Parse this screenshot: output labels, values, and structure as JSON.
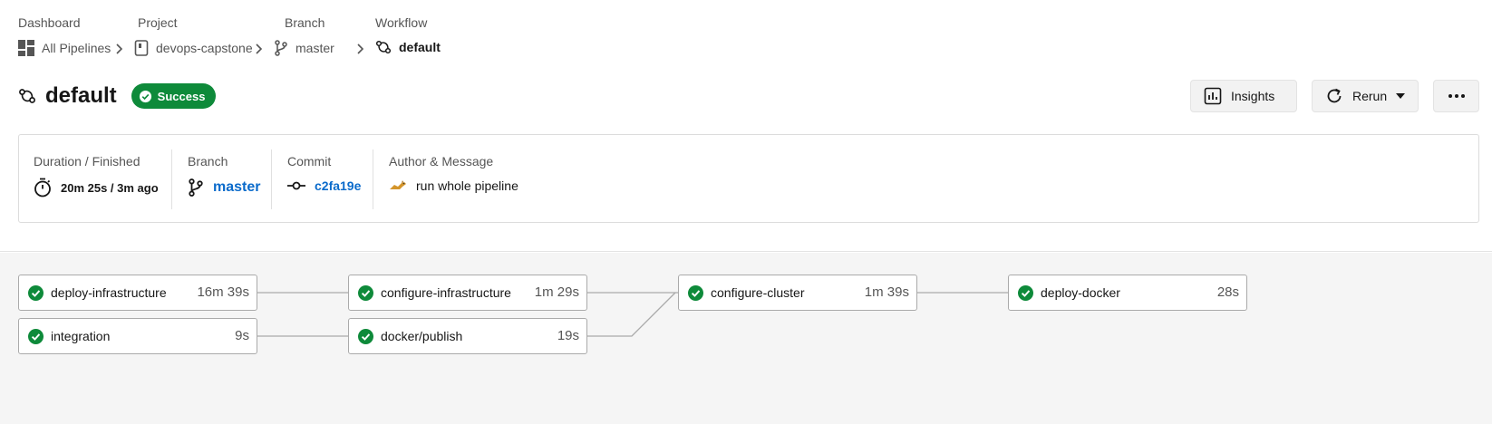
{
  "breadcrumb": {
    "labels": [
      "Dashboard",
      "Project",
      "Branch",
      "Workflow"
    ],
    "items": [
      {
        "label": "All Pipelines",
        "icon": "dashboard-grid-icon"
      },
      {
        "label": "devops-capstone",
        "icon": "repo-icon"
      },
      {
        "label": "master",
        "icon": "branch-icon"
      },
      {
        "label": "default",
        "icon": "workflow-icon"
      }
    ]
  },
  "header": {
    "title": "default",
    "status": "Success",
    "insights_label": "Insights",
    "rerun_label": "Rerun",
    "more_icon": "ellipsis-icon"
  },
  "summary": {
    "duration": {
      "header": "Duration / Finished",
      "value": "20m 25s / 3m ago"
    },
    "branch": {
      "header": "Branch",
      "value": "master"
    },
    "commit": {
      "header": "Commit",
      "value": "c2fa19e"
    },
    "author": {
      "header": "Author & Message",
      "message": "run whole pipeline"
    }
  },
  "jobs": [
    {
      "name": "deploy-infrastructure",
      "duration": "16m 39s",
      "status": "success"
    },
    {
      "name": "integration",
      "duration": "9s",
      "status": "success"
    },
    {
      "name": "configure-infrastructure",
      "duration": "1m 29s",
      "status": "success"
    },
    {
      "name": "docker/publish",
      "duration": "19s",
      "status": "success"
    },
    {
      "name": "configure-cluster",
      "duration": "1m 39s",
      "status": "success"
    },
    {
      "name": "deploy-docker",
      "duration": "28s",
      "status": "success"
    }
  ],
  "colors": {
    "success": "#0e8a3a",
    "link": "#0b6bcb"
  }
}
